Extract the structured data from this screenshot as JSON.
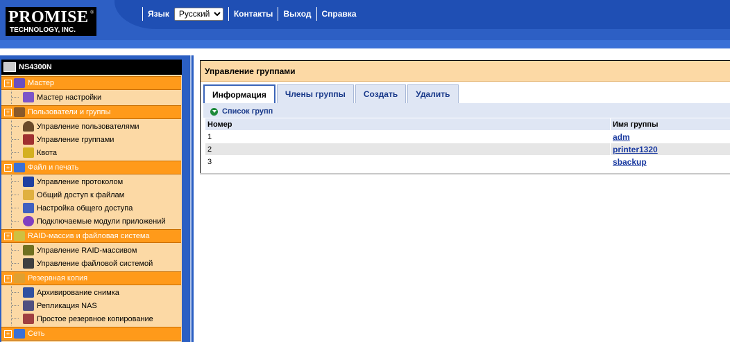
{
  "header": {
    "logo_line1": "PROMISE",
    "logo_line2": "TECHNOLOGY, INC.",
    "logo_reg": "®",
    "language_label": "Язык",
    "language_selected": "Русский",
    "nav": [
      "Контакты",
      "Выход",
      "Справка"
    ]
  },
  "sidebar": {
    "device": "NS4300N",
    "groups": [
      {
        "label": "Мастер",
        "icon": "wizard-icon",
        "items": [
          {
            "label": "Мастер настройки",
            "icon": "wizard-setup-icon"
          }
        ]
      },
      {
        "label": "Пользователи и группы",
        "icon": "users-groups-icon",
        "items": [
          {
            "label": "Управление пользователями",
            "icon": "user-icon"
          },
          {
            "label": "Управление группами",
            "icon": "group-icon"
          },
          {
            "label": "Квота",
            "icon": "quota-icon"
          }
        ]
      },
      {
        "label": "Файл и печать",
        "icon": "file-print-icon",
        "items": [
          {
            "label": "Управление протоколом",
            "icon": "protocol-icon"
          },
          {
            "label": "Общий доступ к файлам",
            "icon": "folder-share-icon"
          },
          {
            "label": "Настройка общего доступа",
            "icon": "share-setup-icon"
          },
          {
            "label": "Подключаемые модули приложений",
            "icon": "plugin-icon"
          }
        ]
      },
      {
        "label": "RAID-массив и файловая система",
        "icon": "raid-icon",
        "items": [
          {
            "label": "Управление RAID-массивом",
            "icon": "raid-manage-icon"
          },
          {
            "label": "Управление файловой системой",
            "icon": "filesystem-icon"
          }
        ]
      },
      {
        "label": "Резервная копия",
        "icon": "backup-icon",
        "items": [
          {
            "label": "Архивирование снимка",
            "icon": "snapshot-icon"
          },
          {
            "label": "Репликация NAS",
            "icon": "replication-icon"
          },
          {
            "label": "Простое резервное копирование",
            "icon": "simple-backup-icon"
          }
        ]
      },
      {
        "label": "Сеть",
        "icon": "network-icon",
        "items": []
      }
    ]
  },
  "main": {
    "title": "Управление группами",
    "tabs": [
      "Информация",
      "Члены группы",
      "Создать",
      "Удалить"
    ],
    "active_tab": "Информация",
    "list_title": "Список групп",
    "columns": [
      "Номер",
      "Имя группы"
    ],
    "rows": [
      {
        "num": "1",
        "name": "adm"
      },
      {
        "num": "2",
        "name": "printer1320"
      },
      {
        "num": "3",
        "name": "sbackup"
      }
    ]
  },
  "colors": {
    "header_blue": "#2d5fc4",
    "group_orange": "#ff9a1a",
    "panel_beige": "#fcd9a5",
    "tab_blue": "#dfe6f4"
  }
}
